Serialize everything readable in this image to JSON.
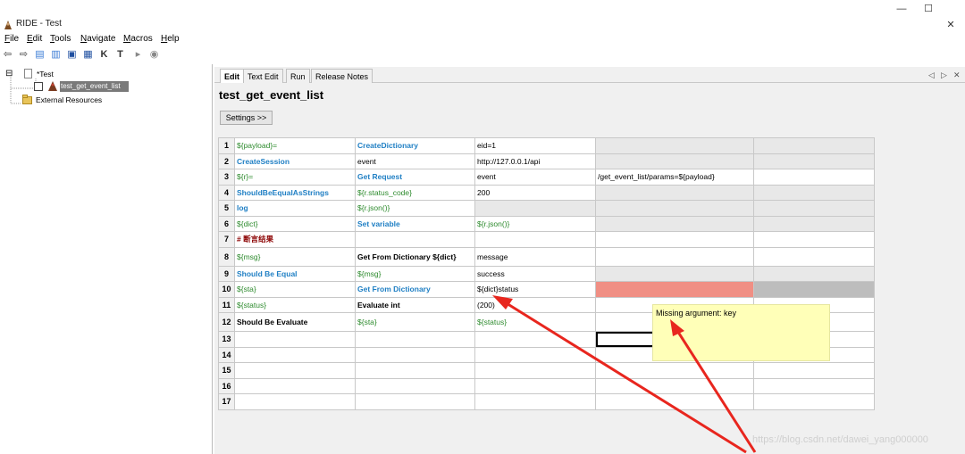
{
  "window": {
    "title": "RIDE - Test",
    "controls": [
      "—",
      "☐",
      "✕"
    ]
  },
  "menu": [
    {
      "key": "F",
      "rest": "ile"
    },
    {
      "key": "E",
      "rest": "dit"
    },
    {
      "key": "T",
      "rest": "ools"
    },
    {
      "key": "N",
      "rest": "avigate"
    },
    {
      "key": "M",
      "rest": "acros"
    },
    {
      "key": "H",
      "rest": "elp"
    }
  ],
  "toolbar": [
    "⇦",
    "⇨",
    "▤",
    "▥",
    "▣",
    "▦",
    "K",
    "T",
    "▸",
    "◉"
  ],
  "tree": {
    "root": "*Test",
    "selected": "test_get_event_list",
    "resources": "External Resources",
    "expander": "⊟"
  },
  "tabs": [
    "Edit",
    "Text Edit",
    "Run",
    "Release Notes"
  ],
  "tab_nav": [
    "◁",
    "▷",
    "✕"
  ],
  "editor": {
    "test_name": "test_get_event_list",
    "settings_label": "Settings >>"
  },
  "grid": [
    {
      "n": "1",
      "cells": [
        {
          "t": "${payload}=",
          "c": "var"
        },
        {
          "t": "CreateDictionary",
          "c": "kw"
        },
        {
          "t": "eid=1",
          "c": ""
        },
        {
          "t": "",
          "c": "lightgray"
        },
        {
          "t": "",
          "c": "lightgray"
        }
      ]
    },
    {
      "n": "2",
      "cells": [
        {
          "t": "CreateSession",
          "c": "kw"
        },
        {
          "t": "event",
          "c": ""
        },
        {
          "t": "http://127.0.0.1/api",
          "c": ""
        },
        {
          "t": "",
          "c": "lightgray"
        },
        {
          "t": "",
          "c": "lightgray"
        }
      ]
    },
    {
      "n": "3",
      "cells": [
        {
          "t": "${r}=",
          "c": "var"
        },
        {
          "t": "Get Request",
          "c": "kw"
        },
        {
          "t": "event",
          "c": ""
        },
        {
          "t": "/get_event_list/params=${payload}",
          "c": ""
        },
        {
          "t": "",
          "c": ""
        }
      ]
    },
    {
      "n": "4",
      "cells": [
        {
          "t": "ShouldBeEqualAsStrings",
          "c": "kw"
        },
        {
          "t": "${r.status_code}",
          "c": "var"
        },
        {
          "t": "200",
          "c": ""
        },
        {
          "t": "",
          "c": "lightgray"
        },
        {
          "t": "",
          "c": "lightgray"
        }
      ]
    },
    {
      "n": "5",
      "cells": [
        {
          "t": "log",
          "c": "kw"
        },
        {
          "t": "${r.json()}",
          "c": "var"
        },
        {
          "t": "",
          "c": "lightgray"
        },
        {
          "t": "",
          "c": "lightgray"
        },
        {
          "t": "",
          "c": "lightgray"
        }
      ]
    },
    {
      "n": "6",
      "cells": [
        {
          "t": "${dict}",
          "c": "var"
        },
        {
          "t": "Set variable",
          "c": "kw"
        },
        {
          "t": "${r.json()}",
          "c": "var"
        },
        {
          "t": "",
          "c": "lightgray"
        },
        {
          "t": "",
          "c": "lightgray"
        }
      ]
    },
    {
      "n": "7",
      "cells": [
        {
          "t": "# 断言结果",
          "c": "cm"
        },
        {
          "t": "",
          "c": ""
        },
        {
          "t": "",
          "c": ""
        },
        {
          "t": "",
          "c": ""
        },
        {
          "t": "",
          "c": ""
        }
      ]
    },
    {
      "n": "8",
      "cells": [
        {
          "t": "${msg}",
          "c": "var"
        },
        {
          "t": "Get From Dictionary ${dict}",
          "c": "bk"
        },
        {
          "t": "message",
          "c": ""
        },
        {
          "t": "",
          "c": ""
        },
        {
          "t": "",
          "c": ""
        }
      ]
    },
    {
      "n": "9",
      "cells": [
        {
          "t": "Should Be Equal",
          "c": "kw"
        },
        {
          "t": "${msg}",
          "c": "var"
        },
        {
          "t": "success",
          "c": ""
        },
        {
          "t": "",
          "c": "lightgray"
        },
        {
          "t": "",
          "c": "lightgray"
        }
      ]
    },
    {
      "n": "10",
      "cells": [
        {
          "t": "${sta}",
          "c": "var"
        },
        {
          "t": "Get From Dictionary",
          "c": "kw"
        },
        {
          "t": "${dict}status",
          "c": ""
        },
        {
          "t": "",
          "c": "err"
        },
        {
          "t": "",
          "c": "gray"
        }
      ]
    },
    {
      "n": "11",
      "cells": [
        {
          "t": "${status}",
          "c": "var"
        },
        {
          "t": "Evaluate int",
          "c": "bk"
        },
        {
          "t": "(200)",
          "c": ""
        },
        {
          "t": "",
          "c": ""
        },
        {
          "t": "",
          "c": ""
        }
      ]
    },
    {
      "n": "12",
      "cells": [
        {
          "t": "Should Be Evaluate",
          "c": "bk"
        },
        {
          "t": "${sta}",
          "c": "var"
        },
        {
          "t": "${status}",
          "c": "var"
        },
        {
          "t": "",
          "c": ""
        },
        {
          "t": "",
          "c": ""
        }
      ]
    },
    {
      "n": "13",
      "cells": [
        {
          "t": "",
          "c": ""
        },
        {
          "t": "",
          "c": ""
        },
        {
          "t": "",
          "c": ""
        },
        {
          "t": "",
          "c": "sel"
        },
        {
          "t": "",
          "c": ""
        }
      ]
    },
    {
      "n": "14",
      "cells": [
        {
          "t": "",
          "c": ""
        },
        {
          "t": "",
          "c": ""
        },
        {
          "t": "",
          "c": ""
        },
        {
          "t": "",
          "c": ""
        },
        {
          "t": "",
          "c": ""
        }
      ]
    },
    {
      "n": "15",
      "cells": [
        {
          "t": "",
          "c": ""
        },
        {
          "t": "",
          "c": ""
        },
        {
          "t": "",
          "c": ""
        },
        {
          "t": "",
          "c": ""
        },
        {
          "t": "",
          "c": ""
        }
      ]
    },
    {
      "n": "16",
      "cells": [
        {
          "t": "",
          "c": ""
        },
        {
          "t": "",
          "c": ""
        },
        {
          "t": "",
          "c": ""
        },
        {
          "t": "",
          "c": ""
        },
        {
          "t": "",
          "c": ""
        }
      ]
    },
    {
      "n": "17",
      "cells": [
        {
          "t": "",
          "c": ""
        },
        {
          "t": "",
          "c": ""
        },
        {
          "t": "",
          "c": ""
        },
        {
          "t": "",
          "c": ""
        },
        {
          "t": "",
          "c": ""
        }
      ]
    }
  ],
  "tooltip": "Missing argument: key",
  "watermark": "https://blog.csdn.net/dawei_yang000000",
  "colors": {
    "keyword": "#1f7fc4",
    "variable": "#2e8b2e",
    "error": "#f08f84",
    "arrow": "#e8261e"
  }
}
